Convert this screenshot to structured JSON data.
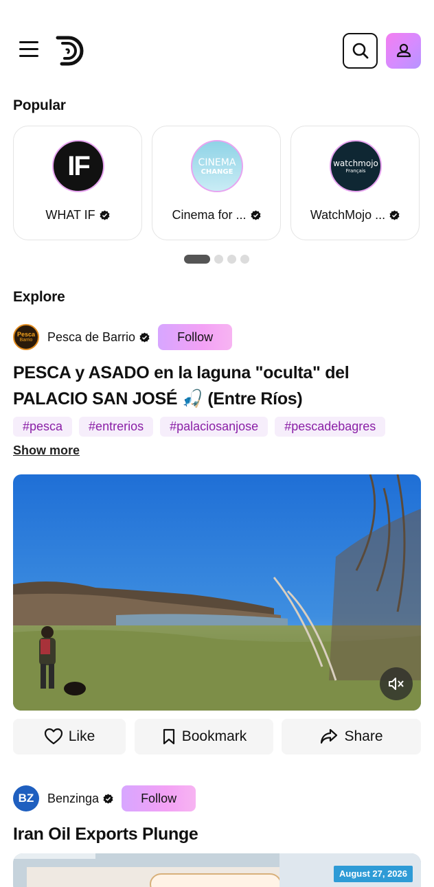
{
  "header": {
    "menu_icon": "hamburger-menu-icon",
    "logo_icon": "d-logo-icon",
    "search_icon": "search-icon",
    "profile_icon": "user-icon"
  },
  "popular": {
    "title": "Popular",
    "channels": [
      {
        "name": "WHAT IF",
        "avatar_text": "IF"
      },
      {
        "name": "Cinema for ...",
        "avatar_text": "CINEMA",
        "avatar_subtext": "CHANGE"
      },
      {
        "name": "WatchMojo ...",
        "avatar_text": "watchmojo",
        "avatar_subtext": "Français"
      }
    ],
    "pager": {
      "count": 4,
      "active": 0
    }
  },
  "explore": {
    "title": "Explore",
    "posts": [
      {
        "channel": "Pesca de Barrio",
        "avatar_text": "Pesca",
        "avatar_subtext": "Barrio",
        "follow_label": "Follow",
        "title_line1": "PESCA y ASADO en la laguna \"oculta\" del",
        "title_line2": "PALACIO SAN JOSÉ 🎣 (Entre Ríos)",
        "tags": [
          "#pesca",
          "#entrerios",
          "#palaciosanjose",
          "#pescadebagres"
        ],
        "show_more": "Show more",
        "mute_icon": "speaker-muted-icon",
        "actions": {
          "like": "Like",
          "bookmark": "Bookmark",
          "share": "Share"
        }
      },
      {
        "channel": "Benzinga",
        "avatar_text": "BZ",
        "follow_label": "Follow",
        "title": "Iran Oil Exports Plunge",
        "date_badge": "August 27, 2026"
      }
    ]
  },
  "colors": {
    "accent_gradient_start": "#d7a6ff",
    "accent_gradient_end": "#f7b4f2",
    "tag_bg": "#f6eefb",
    "tag_text": "#8a1fa6",
    "benzinga_blue": "#1f5fbf"
  }
}
